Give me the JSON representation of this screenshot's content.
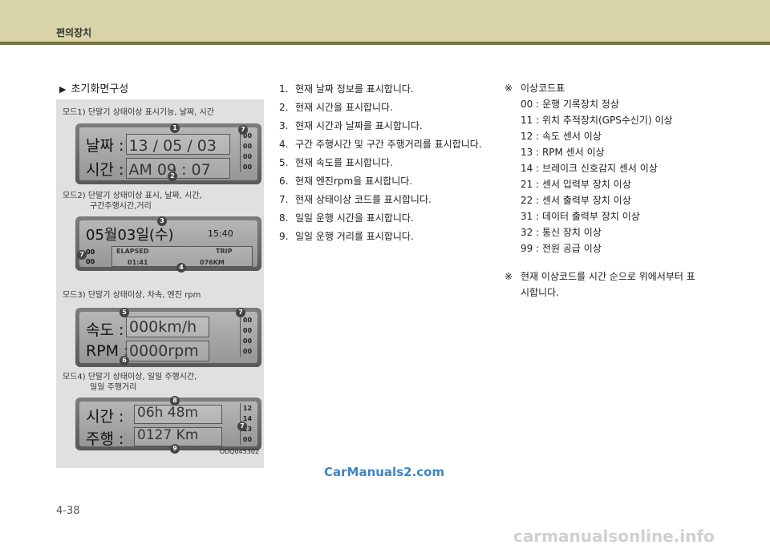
{
  "header": {
    "title": "편의장치"
  },
  "section": {
    "title": "초기화면구성"
  },
  "figure": {
    "mode1": {
      "label": "모드1) 단말기 상태이상 표시기능, 날짜, 시간",
      "line1": "날짜 : 13 / 05 / 03",
      "line2": "시간 : AM  09 : 07",
      "codes": [
        "00",
        "00",
        "00",
        "00"
      ],
      "markers": [
        "1",
        "7",
        "2"
      ]
    },
    "mode2": {
      "label_line1": "모드2) 단말기 상태이상 표시, 날짜, 시간,",
      "label_line2": "구간주행시간,거리",
      "date": "05월03일(수)",
      "time": "15:40",
      "codes": [
        "00",
        "00"
      ],
      "elapsed_label": "ELAPSED",
      "elapsed_value": "01:41",
      "trip_label": "TRIP",
      "trip_value": "076KM",
      "markers": [
        "3",
        "7",
        "4"
      ]
    },
    "mode3": {
      "label": "모드3) 단말기 상태이상, 차속, 엔진 rpm",
      "speed_label": "속도 :",
      "speed_value": "000km/h",
      "rpm_label": "RPM :",
      "rpm_value": "0000rpm",
      "codes": [
        "00",
        "00",
        "00",
        "00"
      ],
      "markers": [
        "5",
        "7",
        "6"
      ]
    },
    "mode4": {
      "label_line1": "모드4) 단말기 상태이상, 일일 주행시간,",
      "label_line2": "일일 주행거리",
      "time_label": "시간 :",
      "time_value": "06h 48m",
      "dist_label": "주행 :",
      "dist_value": "0127 Km",
      "codes": [
        "12",
        "14",
        "13",
        "00"
      ],
      "markers": [
        "8",
        "7",
        "9"
      ]
    },
    "code": "ODQ045302"
  },
  "list1": [
    {
      "num": "1.",
      "text": "현재 날짜 정보를 표시합니다."
    },
    {
      "num": "2.",
      "text": "현재 시간을 표시합니다."
    },
    {
      "num": "3.",
      "text": "현재 시간과 날짜를 표시합니다."
    },
    {
      "num": "4.",
      "text": "구간 주행시간 및 구간 주행거리를 표시합니다."
    },
    {
      "num": "5.",
      "text": "현재 속도를 표시합니다."
    },
    {
      "num": "6.",
      "text": "현재 엔진rpm을 표시합니다."
    },
    {
      "num": "7.",
      "text": "현재 상태이상 코드를 표시합니다."
    },
    {
      "num": "8.",
      "text": "일일 운행 시간을 표시합니다."
    },
    {
      "num": "9.",
      "text": "일일 운행 거리를 표시합니다."
    }
  ],
  "list2": {
    "mark": "※",
    "title": "이상코드표",
    "codes": [
      "00 : 운행 기록장치 정상",
      "11 : 위치 추적장치(GPS수신기) 이상",
      "12 :  속도 센서 이상",
      "13 : RPM 센서 이상",
      "14 : 브레이크 신호감지 센서 이상",
      "21 : 센서 입력부 장치 이상",
      "22 : 센서 출력부 장치 이상",
      "31 : 데이터 출력부 장치 이상",
      "32 : 통신 장치 이상",
      "99 : 전원 공급 이상"
    ],
    "note_line1": "현재 이상코드를 시간 순으로 위에서부터 표",
    "note_line2": "시합니다."
  },
  "watermark1": "CarManuals2.com",
  "page_number": "4-38",
  "watermark2": "carmanualsonline.info"
}
